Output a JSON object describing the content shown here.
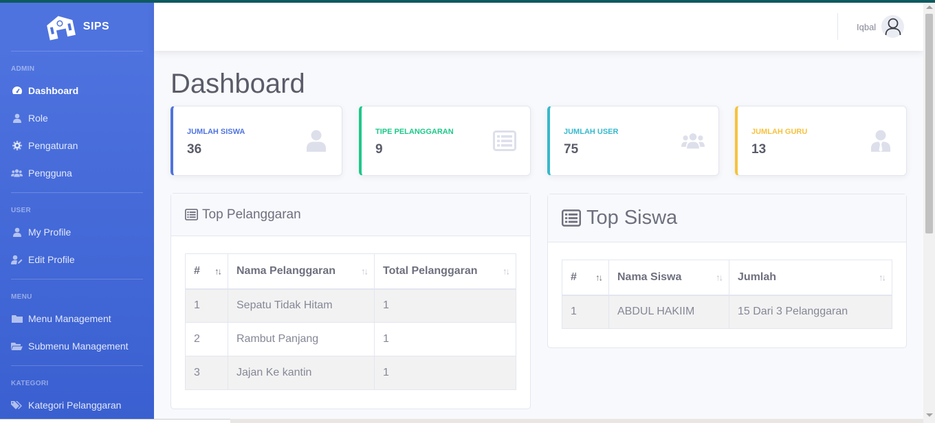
{
  "app": {
    "brand": "SIPS"
  },
  "sidebar": {
    "sections": [
      {
        "heading": "ADMIN",
        "items": [
          {
            "label": "Dashboard",
            "icon": "tachometer-icon",
            "active": true
          },
          {
            "label": "Role",
            "icon": "user-icon"
          },
          {
            "label": "Pengaturan",
            "icon": "gear-icon"
          },
          {
            "label": "Pengguna",
            "icon": "users-icon"
          }
        ]
      },
      {
        "heading": "USER",
        "items": [
          {
            "label": "My Profile",
            "icon": "user-icon"
          },
          {
            "label": "Edit Profile",
            "icon": "user-edit-icon"
          }
        ]
      },
      {
        "heading": "MENU",
        "items": [
          {
            "label": "Menu Management",
            "icon": "folder-icon"
          },
          {
            "label": "Submenu Management",
            "icon": "folder-open-icon"
          }
        ]
      },
      {
        "heading": "KATEGORI",
        "items": [
          {
            "label": "Kategori Pelanggaran",
            "icon": "tags-icon"
          }
        ]
      }
    ]
  },
  "topbar": {
    "username": "Iqbal"
  },
  "page": {
    "title": "Dashboard"
  },
  "stats": [
    {
      "label": "JUMLAH SISWA",
      "value": "36",
      "color": "#4e73df",
      "icon": "user-icon"
    },
    {
      "label": "TIPE PELANGGARAN",
      "value": "9",
      "color": "#1cc88a",
      "icon": "list-alt-icon"
    },
    {
      "label": "JUMLAH USER",
      "value": "75",
      "color": "#36b9cc",
      "icon": "users-icon"
    },
    {
      "label": "JUMLAH GURU",
      "value": "13",
      "color": "#f6c23e",
      "icon": "user-tie-icon"
    }
  ],
  "top_pelanggaran": {
    "title": "Top Pelanggaran",
    "columns": [
      "#",
      "Nama Pelanggaran",
      "Total Pelanggaran"
    ],
    "rows": [
      [
        "1",
        "Sepatu Tidak Hitam",
        "1"
      ],
      [
        "2",
        "Rambut Panjang",
        "1"
      ],
      [
        "3",
        "Jajan Ke kantin",
        "1"
      ]
    ]
  },
  "top_siswa": {
    "title": "Top Siswa",
    "columns": [
      "#",
      "Nama Siswa",
      "Jumlah"
    ],
    "rows": [
      [
        "1",
        "ABDUL HAKIIM",
        "15 Dari 3 Pelanggaran"
      ]
    ]
  }
}
